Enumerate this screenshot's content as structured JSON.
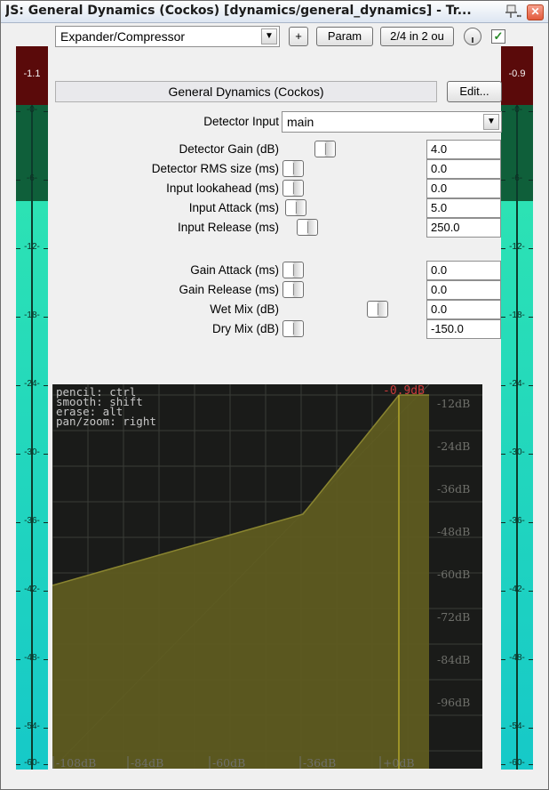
{
  "window": {
    "title": "JS: General Dynamics (Cockos) [dynamics/general_dynamics] - Tr...",
    "close_label": "✕"
  },
  "toolbar": {
    "preset_value": "Expander/Compressor",
    "add_label": "+",
    "param_label": "Param",
    "io_label": "2/4 in 2 ou",
    "enabled_mark": "✓"
  },
  "plugin": {
    "name": "General Dynamics (Cockos)",
    "edit_label": "Edit..."
  },
  "detector_input": {
    "label": "Detector Input",
    "value": "main"
  },
  "params": [
    {
      "label": "Detector Gain (dB)",
      "value": "4.0",
      "position": 0.27
    },
    {
      "label": "Detector RMS size (ms)",
      "value": "0.0",
      "position": 0.0
    },
    {
      "label": "Input lookahead (ms)",
      "value": "0.0",
      "position": 0.0
    },
    {
      "label": "Input Attack (ms)",
      "value": "5.0",
      "position": 0.02
    },
    {
      "label": "Input Release (ms)",
      "value": "250.0",
      "position": 0.12
    },
    {
      "label": "Gain Attack (ms)",
      "value": "0.0",
      "position": 0.0
    },
    {
      "label": "Gain Release (ms)",
      "value": "0.0",
      "position": 0.0
    },
    {
      "label": "Wet Mix (dB)",
      "value": "0.0",
      "position": 0.72
    },
    {
      "label": "Dry Mix (dB)",
      "value": "-150.0",
      "position": 0.0
    }
  ],
  "meters": {
    "left_peak": "-1.1",
    "right_peak": "-0.9",
    "scale": [
      "-0-",
      "-6-",
      "-12-",
      "-18-",
      "-24-",
      "-30-",
      "-36-",
      "-42-",
      "-48-",
      "-54-",
      "-60-"
    ],
    "level_db": -11.5
  },
  "graph": {
    "help_lines": [
      "pencil: ctrl",
      "smooth: shift",
      "erase: alt",
      "pan/zoom: right"
    ],
    "threshold_label": "-0.9dB",
    "y_labels": [
      "-12dB",
      "-24dB",
      "-36dB",
      "-48dB",
      "-60dB",
      "-72dB",
      "-84dB",
      "-96dB"
    ],
    "x_labels": [
      "-108dB",
      "-84dB",
      "-60dB",
      "-36dB",
      "+0dB"
    ],
    "colors": {
      "fill": "#605c1f",
      "edge": "#8a8530",
      "grid": "#3a3c37",
      "label": "#6f706b",
      "marker": "#c93a3a",
      "vline": "#c7b82f"
    }
  }
}
